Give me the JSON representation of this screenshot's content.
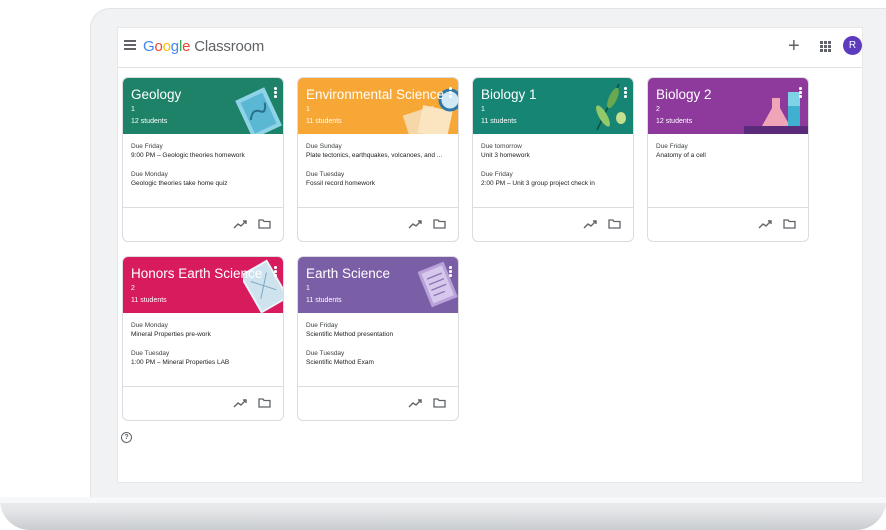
{
  "header": {
    "brand_google": [
      "G",
      "o",
      "o",
      "g",
      "l",
      "e"
    ],
    "brand_product": "Classroom",
    "add_label": "+",
    "avatar_initial": "R",
    "avatar_color": "#5c3bbf"
  },
  "help_label": "?",
  "classes": [
    {
      "name": "Geology",
      "section": "1",
      "students": "12 students",
      "color": "#1e8268",
      "due": [
        {
          "label": "Due Friday",
          "text": "9:00 PM – Geologic theories homework"
        },
        {
          "label": "Due Monday",
          "text": "Geologic theories take home quiz"
        }
      ]
    },
    {
      "name": "Environmental Science",
      "section": "1",
      "students": "11 students",
      "color": "#f7a735",
      "due": [
        {
          "label": "Due Sunday",
          "text": "Plate tectonics, earthquakes, volcanoes, and ..."
        },
        {
          "label": "Due Tuesday",
          "text": "Fossil record homework"
        }
      ]
    },
    {
      "name": "Biology 1",
      "section": "1",
      "students": "11 students",
      "color": "#168573",
      "due": [
        {
          "label": "Due tomorrow",
          "text": "Unit 3 homework"
        },
        {
          "label": "Due Friday",
          "text": "2:00 PM – Unit 3 group project check in"
        }
      ]
    },
    {
      "name": "Biology 2",
      "section": "2",
      "students": "12 students",
      "color": "#8e3a9d",
      "due": [
        {
          "label": "Due Friday",
          "text": "Anatomy of a cell"
        }
      ]
    },
    {
      "name": "Honors Earth Science",
      "section": "2",
      "students": "11 students",
      "color": "#d81b5c",
      "due": [
        {
          "label": "Due Monday",
          "text": "Mineral Properties pre-work"
        },
        {
          "label": "Due Tuesday",
          "text": "1:00 PM – Mineral Properties LAB"
        }
      ]
    },
    {
      "name": "Earth Science",
      "section": "1",
      "students": "11 students",
      "color": "#7b5fa6",
      "due": [
        {
          "label": "Due Friday",
          "text": "Scientific Method presentation"
        },
        {
          "label": "Due Tuesday",
          "text": "Scientific Method Exam"
        }
      ]
    }
  ]
}
